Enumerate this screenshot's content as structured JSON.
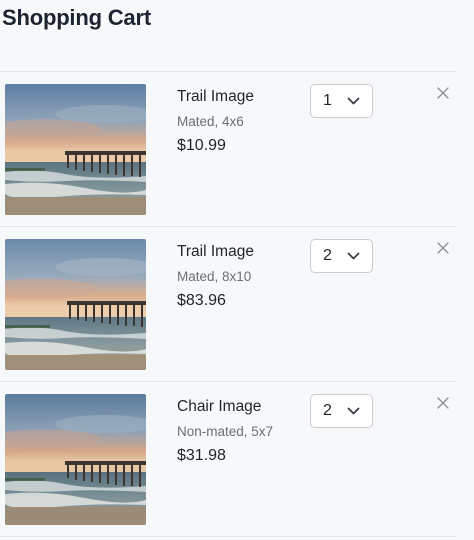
{
  "cart": {
    "title": "Shopping Cart",
    "items": [
      {
        "name": "Trail Image",
        "option": "Mated, 4x6",
        "price": "$10.99",
        "quantity": "1",
        "image_icon": "beach-pier-photo",
        "remove_icon": "close-icon"
      },
      {
        "name": "Trail Image",
        "option": "Mated, 8x10",
        "price": "$83.96",
        "quantity": "2",
        "image_icon": "beach-pier-photo",
        "remove_icon": "close-icon"
      },
      {
        "name": "Chair Image",
        "option": "Non-mated, 5x7",
        "price": "$31.98",
        "quantity": "2",
        "image_icon": "beach-pier-photo",
        "remove_icon": "close-icon"
      }
    ]
  },
  "colors": {
    "background": "#f7f8fa",
    "divider": "#e3e5e8",
    "title": "#1c2430",
    "muted_text": "#6b7078",
    "select_border": "#c9ccd1",
    "icon": "#8a8f96"
  }
}
